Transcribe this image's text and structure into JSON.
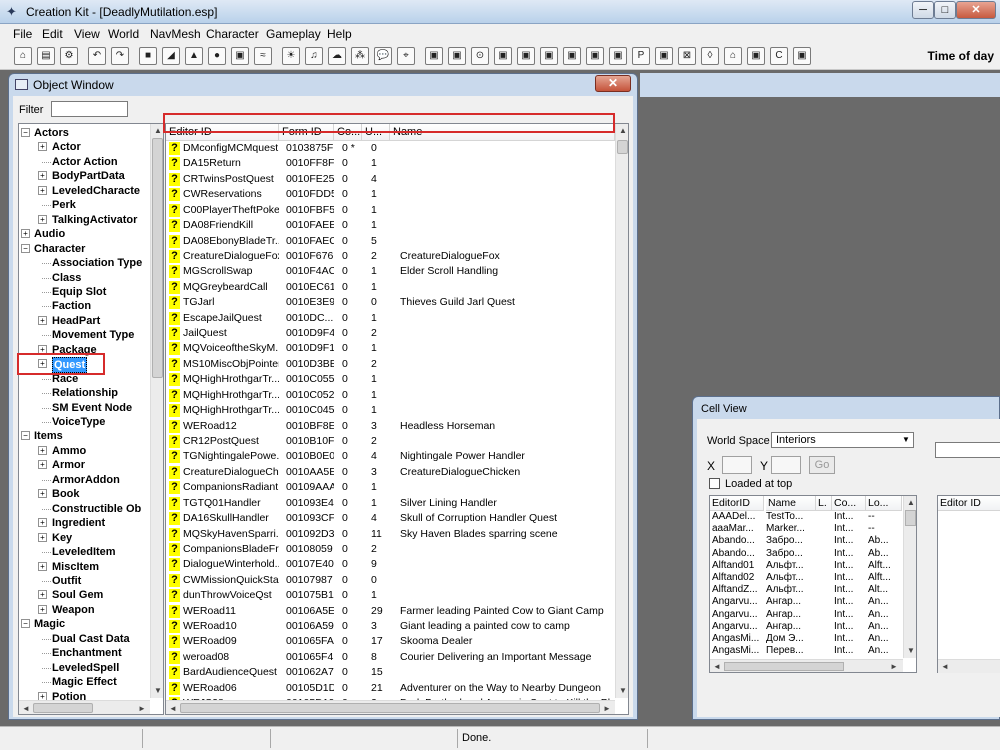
{
  "window": {
    "title": "Creation Kit - [DeadlyMutilation.esp]",
    "controls": {
      "minimize": "─",
      "maximize": "□",
      "close": "✕"
    }
  },
  "menu": [
    "File",
    "Edit",
    "View",
    "World",
    "NavMesh",
    "Character",
    "Gameplay",
    "Help"
  ],
  "toolbar": {
    "icons": [
      "open-icon",
      "save-icon",
      "preferences-icon",
      "undo-icon",
      "redo-icon",
      "render-icon",
      "marker-icon",
      "havok-icon",
      "sky-icon",
      "landscape-icon",
      "water-icon",
      "light-icon",
      "animation-icon",
      "fog-icon",
      "grass-icon",
      "dialogue-icon",
      "navmesh-icon",
      "tool-1-icon",
      "tool-2-icon",
      "tool-3-icon",
      "tool-4-icon",
      "tool-5-icon",
      "tool-6-icon",
      "tool-7-icon",
      "tool-8-icon",
      "tool-9-icon",
      "tool-10-icon",
      "tool-11-icon",
      "tool-12-icon",
      "tool-13-icon",
      "tool-14-icon",
      "tool-15-icon",
      "tool-16-icon",
      "tool-17-icon"
    ],
    "time_label": "Time of day"
  },
  "object_window": {
    "title": "Object Window",
    "close": "✕",
    "filter_label": "Filter",
    "filter_value": "",
    "tree": [
      {
        "label": "Actors",
        "level": 0,
        "expander": "−"
      },
      {
        "label": "Actor",
        "level": 1,
        "expander": "+"
      },
      {
        "label": "Actor Action",
        "level": 1,
        "expander": ""
      },
      {
        "label": "BodyPartData",
        "level": 1,
        "expander": "+"
      },
      {
        "label": "LeveledCharacte",
        "level": 1,
        "expander": "+"
      },
      {
        "label": "Perk",
        "level": 1,
        "expander": ""
      },
      {
        "label": "TalkingActivator",
        "level": 1,
        "expander": "+"
      },
      {
        "label": "Audio",
        "level": 0,
        "expander": "+"
      },
      {
        "label": "Character",
        "level": 0,
        "expander": "−"
      },
      {
        "label": "Association Type",
        "level": 1,
        "expander": ""
      },
      {
        "label": "Class",
        "level": 1,
        "expander": ""
      },
      {
        "label": "Equip Slot",
        "level": 1,
        "expander": ""
      },
      {
        "label": "Faction",
        "level": 1,
        "expander": ""
      },
      {
        "label": "HeadPart",
        "level": 1,
        "expander": "+"
      },
      {
        "label": "Movement Type",
        "level": 1,
        "expander": ""
      },
      {
        "label": "Package",
        "level": 1,
        "expander": "+"
      },
      {
        "label": "Quest",
        "level": 1,
        "expander": "+",
        "selected": true
      },
      {
        "label": "Race",
        "level": 1,
        "expander": ""
      },
      {
        "label": "Relationship",
        "level": 1,
        "expander": ""
      },
      {
        "label": "SM Event Node",
        "level": 1,
        "expander": ""
      },
      {
        "label": "VoiceType",
        "level": 1,
        "expander": ""
      },
      {
        "label": "Items",
        "level": 0,
        "expander": "−"
      },
      {
        "label": "Ammo",
        "level": 1,
        "expander": "+"
      },
      {
        "label": "Armor",
        "level": 1,
        "expander": "+"
      },
      {
        "label": "ArmorAddon",
        "level": 1,
        "expander": ""
      },
      {
        "label": "Book",
        "level": 1,
        "expander": "+"
      },
      {
        "label": "Constructible Ob",
        "level": 1,
        "expander": ""
      },
      {
        "label": "Ingredient",
        "level": 1,
        "expander": "+"
      },
      {
        "label": "Key",
        "level": 1,
        "expander": "+"
      },
      {
        "label": "LeveledItem",
        "level": 1,
        "expander": ""
      },
      {
        "label": "MiscItem",
        "level": 1,
        "expander": "+"
      },
      {
        "label": "Outfit",
        "level": 1,
        "expander": ""
      },
      {
        "label": "Soul Gem",
        "level": 1,
        "expander": "+"
      },
      {
        "label": "Weapon",
        "level": 1,
        "expander": "+"
      },
      {
        "label": "Magic",
        "level": 0,
        "expander": "−"
      },
      {
        "label": "Dual Cast Data",
        "level": 1,
        "expander": ""
      },
      {
        "label": "Enchantment",
        "level": 1,
        "expander": ""
      },
      {
        "label": "LeveledSpell",
        "level": 1,
        "expander": ""
      },
      {
        "label": "Magic Effect",
        "level": 1,
        "expander": ""
      },
      {
        "label": "Potion",
        "level": 1,
        "expander": "+"
      }
    ],
    "columns": [
      "Editor ID",
      "Form ID",
      "Co...",
      "U...",
      "Name"
    ],
    "rows": [
      [
        "DMconfigMCMquest",
        "0103875F",
        "0 *",
        "0",
        ""
      ],
      [
        "DA15Return",
        "0010FF8F",
        "0",
        "1",
        ""
      ],
      [
        "CRTwinsPostQuest",
        "0010FE25",
        "0",
        "4",
        ""
      ],
      [
        "CWReservations",
        "0010FDD5",
        "0",
        "1",
        ""
      ],
      [
        "C00PlayerTheftPoke",
        "0010FBF5",
        "0",
        "1",
        ""
      ],
      [
        "DA08FriendKill",
        "0010FAEE",
        "0",
        "1",
        ""
      ],
      [
        "DA08EbonyBladeTr...",
        "0010FAEC",
        "0",
        "5",
        ""
      ],
      [
        "CreatureDialogueFox",
        "0010F676",
        "0",
        "2",
        "CreatureDialogueFox"
      ],
      [
        "MGScrollSwap",
        "0010F4AC",
        "0",
        "1",
        "Elder Scroll Handling"
      ],
      [
        "MQGreybeardCall",
        "0010EC61",
        "0",
        "1",
        ""
      ],
      [
        "TGJarl",
        "0010E3E9",
        "0",
        "0",
        "Thieves Guild Jarl Quest"
      ],
      [
        "EscapeJailQuest",
        "0010DC...",
        "0",
        "1",
        ""
      ],
      [
        "JailQuest",
        "0010D9F4",
        "0",
        "2",
        ""
      ],
      [
        "MQVoiceoftheSkyM...",
        "0010D9F1",
        "0",
        "1",
        ""
      ],
      [
        "MS10MiscObjPointer",
        "0010D3BB",
        "0",
        "2",
        ""
      ],
      [
        "MQHighHrothgarTr...",
        "0010C055",
        "0",
        "1",
        ""
      ],
      [
        "MQHighHrothgarTr...",
        "0010C052",
        "0",
        "1",
        ""
      ],
      [
        "MQHighHrothgarTr...",
        "0010C045",
        "0",
        "1",
        ""
      ],
      [
        "WERoad12",
        "0010BF8E",
        "0",
        "3",
        "Headless Horseman"
      ],
      [
        "CR12PostQuest",
        "0010B10F",
        "0",
        "2",
        ""
      ],
      [
        "TGNightingalePowe...",
        "0010B0E0",
        "0",
        "4",
        "Nightingale Power Handler"
      ],
      [
        "CreatureDialogueCh...",
        "0010AA5E",
        "0",
        "3",
        "CreatureDialogueChicken"
      ],
      [
        "CompanionsRadiant...",
        "00109AAA",
        "0",
        "1",
        ""
      ],
      [
        "TGTQ01Handler",
        "001093E4",
        "0",
        "1",
        "Silver Lining Handler"
      ],
      [
        "DA16SkullHandler",
        "001093CF",
        "0",
        "4",
        "Skull of Corruption Handler Quest"
      ],
      [
        "MQSkyHavenSparri...",
        "001092D3",
        "0",
        "11",
        "Sky Haven Blades sparring scene"
      ],
      [
        "CompanionsBladeFr...",
        "00108059",
        "0",
        "2",
        ""
      ],
      [
        "DialogueWinterhold...",
        "00107E40",
        "0",
        "9",
        ""
      ],
      [
        "CWMissionQuickStart",
        "00107987",
        "0",
        "0",
        ""
      ],
      [
        "dunThrowVoiceQst",
        "001075B1",
        "0",
        "1",
        ""
      ],
      [
        "WERoad11",
        "00106A5E",
        "0",
        "29",
        "Farmer leading Painted Cow to Giant Camp"
      ],
      [
        "WERoad10",
        "00106A59",
        "0",
        "3",
        "Giant leading a painted cow to camp"
      ],
      [
        "WERoad09",
        "001065FA",
        "0",
        "17",
        "Skooma Dealer"
      ],
      [
        "weroad08",
        "001065F4",
        "0",
        "8",
        "Courier Delivering an Important Message"
      ],
      [
        "BardAudienceQuest",
        "001062A7",
        "0",
        "15",
        ""
      ],
      [
        "WERoad06",
        "00105D1D",
        "0",
        "21",
        "Adventurer on the Way to Nearby Dungeon"
      ],
      [
        "WEJS28",
        "00105D19",
        "0",
        "2",
        "Dark Brotherhood Assassin Sent to Kill the Player"
      ],
      [
        "WERoad07",
        "00105D15",
        "0",
        "15",
        "Taunting Adventurer"
      ]
    ]
  },
  "cell_view": {
    "title": "Cell View",
    "worldspace_label": "World Space",
    "worldspace_value": "Interiors",
    "x_label": "X",
    "y_label": "Y",
    "go_label": "Go",
    "loaded_at_top_label": "Loaded at top",
    "columns": [
      "EditorID",
      "Name",
      "L.",
      "Co...",
      "Lo..."
    ],
    "rows": [
      [
        "AAADel...",
        "TestTo...",
        "",
        "Int...",
        "--"
      ],
      [
        "aaaMar...",
        "Marker...",
        "",
        "Int...",
        "--"
      ],
      [
        "Abando...",
        "Забро...",
        "",
        "Int...",
        "Ab..."
      ],
      [
        "Abando...",
        "Забро...",
        "",
        "Int...",
        "Ab..."
      ],
      [
        "Alftand01",
        "Альфт...",
        "",
        "Int...",
        "Alft..."
      ],
      [
        "Alftand02",
        "Альфт...",
        "",
        "Int...",
        "Alft..."
      ],
      [
        "AlftandZ...",
        "Альфт...",
        "",
        "Int...",
        "Alt..."
      ],
      [
        "Angarvu...",
        "Ангар...",
        "",
        "Int...",
        "An..."
      ],
      [
        "Angarvu...",
        "Ангар...",
        "",
        "Int...",
        "An..."
      ],
      [
        "Angarvu...",
        "Ангар...",
        "",
        "Int...",
        "An..."
      ],
      [
        "AngasMi...",
        "Дом Э...",
        "",
        "Int...",
        "An..."
      ],
      [
        "AngasMi...",
        "Перев...",
        "",
        "Int...",
        "An..."
      ]
    ],
    "right_column": "Editor ID"
  },
  "status": {
    "text": "Done."
  }
}
